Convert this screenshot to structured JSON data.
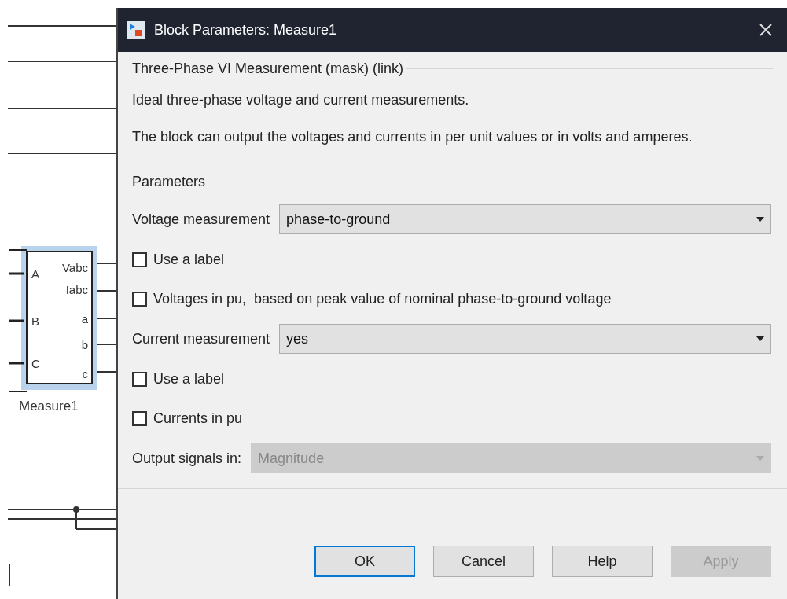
{
  "diagram": {
    "block": {
      "name": "Measure1",
      "inputs": [
        "A",
        "B",
        "C"
      ],
      "outputs": [
        "Vabc",
        "Iabc",
        "a",
        "b",
        "c"
      ],
      "selected": true
    }
  },
  "window": {
    "title": "Block Parameters: Measure1"
  },
  "description": {
    "group_title": "Three-Phase VI Measurement (mask) (link)",
    "paragraphs": [
      "Ideal three-phase voltage and current measurements.",
      "The block can output the voltages and currents in per unit values or in volts and amperes."
    ]
  },
  "parameters": {
    "title": "Parameters",
    "items": [
      {
        "kind": "dropdown",
        "label": "Voltage measurement",
        "value": "phase-to-ground",
        "disabled": false
      },
      {
        "kind": "checkbox",
        "label": "Use a label",
        "checked": false
      },
      {
        "kind": "checkbox",
        "label": "Voltages in pu,  based on peak value of nominal phase-to-ground voltage",
        "checked": false
      },
      {
        "kind": "dropdown",
        "label": "Current measurement",
        "value": "yes",
        "disabled": false
      },
      {
        "kind": "checkbox",
        "label": "Use a label",
        "checked": false
      },
      {
        "kind": "checkbox",
        "label": "Currents in pu",
        "checked": false
      },
      {
        "kind": "dropdown",
        "label": "Output signals in:",
        "value": "Magnitude",
        "disabled": true
      }
    ]
  },
  "buttons": [
    {
      "label": "OK",
      "default": true,
      "disabled": false
    },
    {
      "label": "Cancel",
      "default": false,
      "disabled": false
    },
    {
      "label": "Help",
      "default": false,
      "disabled": false
    },
    {
      "label": "Apply",
      "default": false,
      "disabled": true
    }
  ]
}
